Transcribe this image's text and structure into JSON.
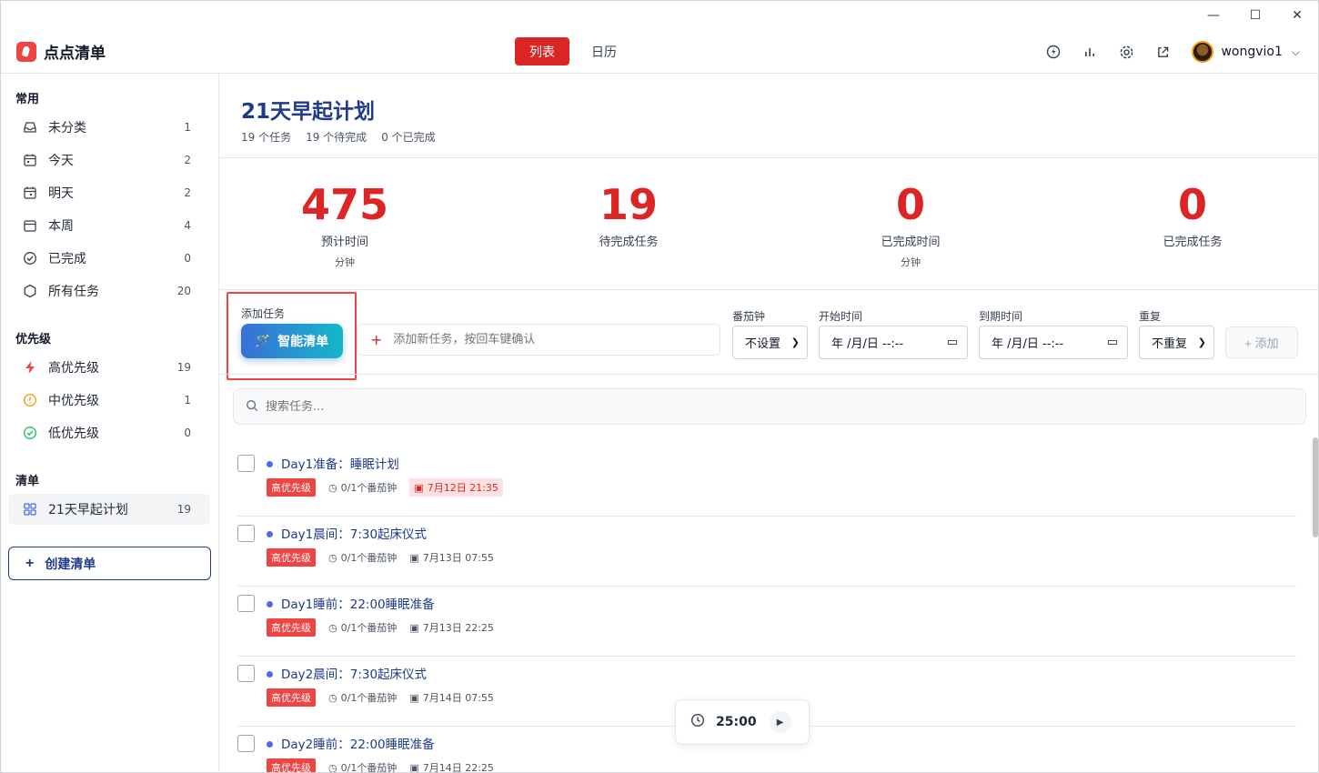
{
  "app": {
    "name": "点点清单"
  },
  "window": {
    "minimize": "—",
    "maximize": "☐",
    "close": "✕"
  },
  "view_tabs": [
    {
      "label": "列表",
      "active": true
    },
    {
      "label": "日历",
      "active": false
    }
  ],
  "header": {
    "icons": [
      "energy-icon",
      "stats-icon",
      "settings-icon",
      "external-link-icon"
    ],
    "username": "wongvio1"
  },
  "sidebar": {
    "common_title": "常用",
    "common": [
      {
        "label": "未分类",
        "count": "1",
        "icon": "inbox-icon"
      },
      {
        "label": "今天",
        "count": "2",
        "icon": "calendar-today-icon"
      },
      {
        "label": "明天",
        "count": "2",
        "icon": "calendar-tomorrow-icon"
      },
      {
        "label": "本周",
        "count": "4",
        "icon": "calendar-week-icon"
      },
      {
        "label": "已完成",
        "count": "0",
        "icon": "check-circle-icon"
      },
      {
        "label": "所有任务",
        "count": "20",
        "icon": "hexagon-icon"
      }
    ],
    "priority_title": "优先级",
    "priority": [
      {
        "label": "高优先级",
        "count": "19",
        "icon": "lightning-icon",
        "color": "#ef4444"
      },
      {
        "label": "中优先级",
        "count": "1",
        "icon": "clock-alert-icon",
        "color": "#f59e0b"
      },
      {
        "label": "低优先级",
        "count": "0",
        "icon": "check-circle-icon",
        "color": "#22c55e"
      }
    ],
    "lists_title": "清单",
    "lists": [
      {
        "label": "21天早起计划",
        "count": "19",
        "icon": "grid-icon"
      }
    ],
    "create_label": "创建清单"
  },
  "main": {
    "title": "21天早起计划",
    "meta": [
      "19 个任务",
      "19 个待完成",
      "0 个已完成"
    ],
    "stats": [
      {
        "value": "475",
        "label": "预计时间",
        "unit": "分钟"
      },
      {
        "value": "19",
        "label": "待完成任务",
        "unit": ""
      },
      {
        "value": "0",
        "label": "已完成时间",
        "unit": "分钟"
      },
      {
        "value": "0",
        "label": "已完成任务",
        "unit": ""
      }
    ],
    "add_task": {
      "label": "添加任务",
      "smart_button": "智能清单",
      "placeholder": "添加新任务，按回车键确认",
      "pomodoro_label": "番茄钟",
      "pomodoro_value": "不设置",
      "start_label": "开始时间",
      "start_value": "年 /月/日 --:--",
      "due_label": "到期时间",
      "due_value": "年 /月/日 --:--",
      "repeat_label": "重复",
      "repeat_value": "不重复",
      "add_button": "+ 添加"
    },
    "search_placeholder": "搜索任务...",
    "tasks": [
      {
        "title": "Day1准备：睡眠计划",
        "priority": "高优先级",
        "pomodoro": "0/1个番茄钟",
        "due": "7月12日 21:35",
        "overdue": true
      },
      {
        "title": "Day1晨间：7:30起床仪式",
        "priority": "高优先级",
        "pomodoro": "0/1个番茄钟",
        "due": "7月13日 07:55",
        "overdue": false
      },
      {
        "title": "Day1睡前：22:00睡眠准备",
        "priority": "高优先级",
        "pomodoro": "0/1个番茄钟",
        "due": "7月13日 22:25",
        "overdue": false
      },
      {
        "title": "Day2晨间：7:30起床仪式",
        "priority": "高优先级",
        "pomodoro": "0/1个番茄钟",
        "due": "7月14日 07:55",
        "overdue": false
      },
      {
        "title": "Day2睡前：22:00睡眠准备",
        "priority": "高优先级",
        "pomodoro": "0/1个番茄钟",
        "due": "7月14日 22:25",
        "overdue": false
      }
    ],
    "timer": {
      "time": "25:00"
    }
  }
}
